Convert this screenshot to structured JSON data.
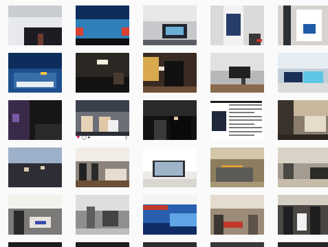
{
  "grid": {
    "background": "#fafafa",
    "tiles": [
      {
        "row": 0,
        "col": 0,
        "bg": "#e7e9ec",
        "blocks": [
          {
            "t": "#c9ccd1",
            "l": 0,
            "w": 100,
            "h": 30
          },
          {
            "t": "#1c1c22",
            "l": 30,
            "w": 70,
            "h": 45,
            "b": 0
          },
          {
            "t": "#6d3b2e",
            "l": 55,
            "w": 10,
            "h": 30,
            "b": 0
          }
        ]
      },
      {
        "row": 0,
        "col": 1,
        "bg": "#2f7fb9",
        "blocks": [
          {
            "t": "#0e2d5a",
            "l": 0,
            "w": 100,
            "h": 35
          },
          {
            "t": "#d94130",
            "l": 0,
            "w": 14,
            "h": 20,
            "b": 25
          },
          {
            "t": "#d94130",
            "l": 86,
            "w": 14,
            "h": 20,
            "b": 25
          },
          {
            "t": "#0f0f14",
            "l": 0,
            "w": 100,
            "h": 18,
            "b": 0
          }
        ]
      },
      {
        "row": 0,
        "col": 2,
        "bg": "#c6c8cb",
        "blocks": [
          {
            "t": "#e8e8e8",
            "l": 0,
            "w": 100,
            "h": 40
          },
          {
            "t": "#20262f",
            "l": 36,
            "w": 46,
            "h": 36,
            "b": 18
          },
          {
            "t": "#6aaed6",
            "l": 42,
            "w": 34,
            "h": 20,
            "b": 26
          },
          {
            "t": "#5a5e64",
            "l": 0,
            "w": 100,
            "h": 14,
            "b": 0
          }
        ]
      },
      {
        "row": 0,
        "col": 3,
        "bg": "#dadada",
        "blocks": [
          {
            "t": "#f2f2f2",
            "l": 24,
            "w": 38,
            "h": 100
          },
          {
            "t": "#263d6a",
            "l": 30,
            "w": 26,
            "h": 56,
            "b": 24
          },
          {
            "t": "#3a3a3a",
            "l": 72,
            "w": 22,
            "h": 30,
            "b": 0
          },
          {
            "t": "#c8372a",
            "l": 86,
            "w": 10,
            "h": 8,
            "b": 8
          }
        ]
      },
      {
        "row": 0,
        "col": 4,
        "bg": "#d7d4cf",
        "blocks": [
          {
            "t": "#ffffff",
            "l": 34,
            "w": 48,
            "h": 80,
            "b": 10
          },
          {
            "t": "#1e5aa6",
            "l": 48,
            "w": 22,
            "h": 24,
            "b": 30
          },
          {
            "t": "#2c2f33",
            "l": 10,
            "w": 14,
            "h": 100
          }
        ]
      },
      {
        "row": 1,
        "col": 0,
        "bg": "#1c4f8c",
        "blocks": [
          {
            "t": "#0d2e5c",
            "l": 0,
            "w": 100,
            "h": 40
          },
          {
            "t": "#3a6ea8",
            "l": 10,
            "w": 80,
            "h": 40,
            "b": 10
          },
          {
            "t": "#e7eef6",
            "l": 15,
            "w": 70,
            "h": 14,
            "b": 14
          },
          {
            "t": "#f4c542",
            "l": 60,
            "w": 12,
            "h": 8,
            "b": 44
          }
        ]
      },
      {
        "row": 1,
        "col": 1,
        "bg": "#2b2723",
        "blocks": [
          {
            "t": "#f5efe0",
            "l": 40,
            "w": 20,
            "h": 12,
            "b": 70
          },
          {
            "t": "#151311",
            "l": 0,
            "w": 100,
            "h": 40,
            "b": 0
          },
          {
            "t": "#4a3a2e",
            "l": 70,
            "w": 20,
            "h": 30,
            "b": 20
          }
        ]
      },
      {
        "row": 1,
        "col": 2,
        "bg": "#3a2b22",
        "blocks": [
          {
            "t": "#d8a94e",
            "l": 0,
            "w": 30,
            "h": 60,
            "b": 30
          },
          {
            "t": "#111111",
            "l": 40,
            "w": 36,
            "h": 80,
            "b": 0
          },
          {
            "t": "#f0e6d6",
            "l": 30,
            "w": 10,
            "h": 10,
            "b": 55
          },
          {
            "t": "#6b4d36",
            "l": 0,
            "w": 100,
            "h": 16,
            "b": 0
          }
        ]
      },
      {
        "row": 1,
        "col": 3,
        "bg": "#b8b8b8",
        "blocks": [
          {
            "t": "#e1e1e1",
            "l": 0,
            "w": 100,
            "h": 45
          },
          {
            "t": "#202020",
            "l": 34,
            "w": 40,
            "h": 30,
            "b": 36
          },
          {
            "t": "#3c3c3c",
            "l": 58,
            "w": 8,
            "h": 36,
            "b": 0
          },
          {
            "t": "#8a6b4e",
            "l": 0,
            "w": 100,
            "h": 20,
            "b": 0
          }
        ]
      },
      {
        "row": 1,
        "col": 4,
        "bg": "#c3cfd8",
        "blocks": [
          {
            "t": "#e6edf2",
            "l": 0,
            "w": 100,
            "h": 40
          },
          {
            "t": "#1a2f56",
            "l": 12,
            "w": 34,
            "h": 26,
            "b": 26
          },
          {
            "t": "#5dc6e6",
            "l": 48,
            "w": 36,
            "h": 30,
            "b": 24
          },
          {
            "t": "#dcdcdc",
            "l": 0,
            "w": 100,
            "h": 24,
            "b": 0
          }
        ]
      },
      {
        "row": 2,
        "col": 0,
        "bg": "#181616",
        "blocks": [
          {
            "t": "#3a2a4a",
            "l": 0,
            "w": 40,
            "h": 100
          },
          {
            "t": "#7b5aa3",
            "l": 8,
            "w": 12,
            "h": 20,
            "b": 45
          },
          {
            "t": "#2a2a2a",
            "l": 50,
            "w": 50,
            "h": 40,
            "b": 0
          }
        ]
      },
      {
        "row": 2,
        "col": 1,
        "bg": "#6c6f78",
        "like": true,
        "blocks": [
          {
            "t": "#3a3f4c",
            "l": 0,
            "w": 100,
            "h": 30
          },
          {
            "t": "#e6d2b8",
            "l": 10,
            "w": 22,
            "h": 40,
            "b": 20
          },
          {
            "t": "#e0c7a8",
            "l": 44,
            "w": 22,
            "h": 38,
            "b": 20
          },
          {
            "t": "#f0f0f0",
            "l": 60,
            "w": 20,
            "h": 30,
            "b": 20
          },
          {
            "t": "#2b2e36",
            "l": 0,
            "w": 100,
            "h": 20,
            "b": 0
          }
        ]
      },
      {
        "row": 2,
        "col": 2,
        "bg": "#121212",
        "blocks": [
          {
            "t": "#2a2a2a",
            "l": 0,
            "w": 100,
            "h": 40
          },
          {
            "t": "#3a3a3a",
            "l": 20,
            "w": 24,
            "h": 50,
            "b": 0
          },
          {
            "t": "#0a0a0a",
            "l": 50,
            "w": 40,
            "h": 60,
            "b": 0
          },
          {
            "t": "#d6c2a4",
            "l": 58,
            "w": 8,
            "h": 8,
            "b": 50
          }
        ]
      },
      {
        "row": 2,
        "col": 3,
        "bg": "#ffffff",
        "text": true,
        "blocks": [
          {
            "t": "#1e2a3a",
            "l": 2,
            "w": 28,
            "h": 50,
            "b": 22
          }
        ]
      },
      {
        "row": 2,
        "col": 4,
        "bg": "#8a7d6e",
        "blocks": [
          {
            "t": "#c9b79c",
            "l": 0,
            "w": 100,
            "h": 40
          },
          {
            "t": "#3a332c",
            "l": 0,
            "w": 30,
            "h": 100
          },
          {
            "t": "#e7dccb",
            "l": 50,
            "w": 40,
            "h": 40,
            "b": 20
          },
          {
            "t": "#2a2520",
            "l": 0,
            "w": 100,
            "h": 14,
            "b": 0
          }
        ]
      },
      {
        "row": 3,
        "col": 0,
        "bg": "#1e1d24",
        "blocks": [
          {
            "t": "#9db0c9",
            "l": 0,
            "w": 100,
            "h": 40
          },
          {
            "t": "#2e2d36",
            "l": 0,
            "w": 100,
            "h": 60,
            "b": 0
          },
          {
            "t": "#d8c9b0",
            "l": 30,
            "w": 8,
            "h": 10,
            "b": 40
          },
          {
            "t": "#d8c9b0",
            "l": 60,
            "w": 8,
            "h": 10,
            "b": 44
          }
        ]
      },
      {
        "row": 3,
        "col": 1,
        "bg": "#8c847c",
        "blocks": [
          {
            "t": "#f1ede6",
            "l": 0,
            "w": 100,
            "h": 35
          },
          {
            "t": "#222222",
            "l": 6,
            "w": 14,
            "h": 50,
            "b": 10
          },
          {
            "t": "#2a2a2a",
            "l": 30,
            "w": 12,
            "h": 50,
            "b": 10
          },
          {
            "t": "#e6ddd0",
            "l": 55,
            "w": 40,
            "h": 30,
            "b": 16
          },
          {
            "t": "#6b4f37",
            "l": 0,
            "w": 100,
            "h": 18,
            "b": 0
          }
        ]
      },
      {
        "row": 3,
        "col": 2,
        "bg": "#eceae6",
        "blocks": [
          {
            "t": "#ffffff",
            "l": 0,
            "w": 100,
            "h": 60
          },
          {
            "t": "#2b3036",
            "l": 18,
            "w": 60,
            "h": 42,
            "b": 26
          },
          {
            "t": "#9fb4c9",
            "l": 22,
            "w": 52,
            "h": 34,
            "b": 30
          },
          {
            "t": "#d9d6d1",
            "l": 0,
            "w": 100,
            "h": 20,
            "b": 0
          }
        ]
      },
      {
        "row": 3,
        "col": 3,
        "bg": "#8b7d5e",
        "blocks": [
          {
            "t": "#d3c7a9",
            "l": 0,
            "w": 100,
            "h": 30
          },
          {
            "t": "#e2a23a",
            "l": 20,
            "w": 40,
            "h": 16,
            "b": 40
          },
          {
            "t": "#5c5a55",
            "l": 10,
            "w": 70,
            "h": 40,
            "b": 10
          },
          {
            "t": "#a89878",
            "l": 0,
            "w": 100,
            "h": 14,
            "b": 0
          }
        ]
      },
      {
        "row": 3,
        "col": 4,
        "bg": "#a49c90",
        "blocks": [
          {
            "t": "#d9d2c6",
            "l": 0,
            "w": 100,
            "h": 40
          },
          {
            "t": "#4a4844",
            "l": 10,
            "w": 20,
            "h": 40,
            "b": 20
          },
          {
            "t": "#2c2a27",
            "l": 60,
            "w": 34,
            "h": 30,
            "b": 20
          },
          {
            "t": "#c7bca9",
            "l": 0,
            "w": 100,
            "h": 20,
            "b": 0
          }
        ]
      },
      {
        "row": 4,
        "col": 0,
        "bg": "#7c7a78",
        "blocks": [
          {
            "t": "#f3f1ec",
            "l": 0,
            "w": 100,
            "h": 35
          },
          {
            "t": "#2a2a2a",
            "l": 10,
            "w": 20,
            "h": 60,
            "b": 0
          },
          {
            "t": "#e6e2dc",
            "l": 40,
            "w": 40,
            "h": 26,
            "b": 18
          },
          {
            "t": "#3a4cb0",
            "l": 50,
            "w": 20,
            "h": 8,
            "b": 26
          }
        ]
      },
      {
        "row": 4,
        "col": 1,
        "bg": "#8f8f8f",
        "blocks": [
          {
            "t": "#dedede",
            "l": 0,
            "w": 100,
            "h": 40
          },
          {
            "t": "#5e5e5e",
            "l": 20,
            "w": 16,
            "h": 60,
            "b": 10
          },
          {
            "t": "#444444",
            "l": 50,
            "w": 30,
            "h": 40,
            "b": 20
          },
          {
            "t": "#bdbdbd",
            "l": 0,
            "w": 100,
            "h": 16,
            "b": 0
          }
        ]
      },
      {
        "row": 4,
        "col": 2,
        "bg": "#2a5fb0",
        "banner": true,
        "blocks": [
          {
            "t": "#f3f3f3",
            "l": 0,
            "w": 100,
            "h": 24
          },
          {
            "t": "#c0392b",
            "l": 0,
            "w": 46,
            "h": 12,
            "b": 62
          },
          {
            "t": "#0f2c66",
            "l": 0,
            "w": 100,
            "h": 30,
            "b": 0
          },
          {
            "t": "#5fa5e6",
            "l": 50,
            "w": 50,
            "h": 34,
            "b": 20
          }
        ]
      },
      {
        "row": 4,
        "col": 3,
        "bg": "#9b8b78",
        "blocks": [
          {
            "t": "#e3dccf",
            "l": 0,
            "w": 100,
            "h": 35
          },
          {
            "t": "#c0392b",
            "l": 20,
            "w": 40,
            "h": 14,
            "b": 18
          },
          {
            "t": "#3b3631",
            "l": 6,
            "w": 18,
            "h": 50,
            "b": 0
          },
          {
            "t": "#5c524a",
            "l": 70,
            "w": 18,
            "h": 50,
            "b": 0
          }
        ]
      },
      {
        "row": 4,
        "col": 4,
        "bg": "#4a4642",
        "blocks": [
          {
            "t": "#d4cdc2",
            "l": 0,
            "w": 100,
            "h": 25
          },
          {
            "t": "#1f1f22",
            "l": 10,
            "w": 18,
            "h": 70,
            "b": 0
          },
          {
            "t": "#1f1f22",
            "l": 60,
            "w": 20,
            "h": 70,
            "b": 0
          },
          {
            "t": "#f2f2f2",
            "l": 36,
            "w": 18,
            "h": 44,
            "b": 10
          }
        ]
      },
      {
        "row": 5,
        "col": 0,
        "bg": "#1b1b1b",
        "blocks": []
      },
      {
        "row": 5,
        "col": 1,
        "bg": "#1d1d1d",
        "blocks": []
      },
      {
        "row": 5,
        "col": 2,
        "bg": "#2d2d2d",
        "blocks": []
      },
      {
        "row": 5,
        "col": 3,
        "bg": "#383838",
        "blocks": []
      },
      {
        "row": 5,
        "col": 4,
        "bg": "#262626",
        "blocks": []
      }
    ]
  }
}
